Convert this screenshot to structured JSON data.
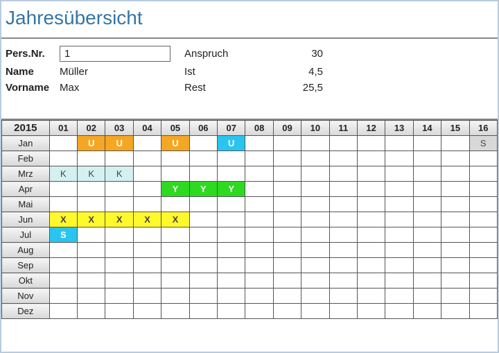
{
  "title": "Jahresübersicht",
  "info": {
    "persnr_label": "Pers.Nr.",
    "persnr_value": "1",
    "name_label": "Name",
    "name_value": "Müller",
    "vorname_label": "Vorname",
    "vorname_value": "Max",
    "anspruch_label": "Anspruch",
    "anspruch_value": "30",
    "ist_label": "Ist",
    "ist_value": "4,5",
    "rest_label": "Rest",
    "rest_value": "25,5"
  },
  "calendar": {
    "year": "2015",
    "days": [
      "01",
      "02",
      "03",
      "04",
      "05",
      "06",
      "07",
      "08",
      "09",
      "10",
      "11",
      "12",
      "13",
      "14",
      "15",
      "16"
    ],
    "months": [
      "Jan",
      "Feb",
      "Mrz",
      "Apr",
      "Mai",
      "Jun",
      "Jul",
      "Aug",
      "Sep",
      "Okt",
      "Nov",
      "Dez"
    ],
    "cells": {
      "Jan": {
        "02": {
          "v": "U",
          "c": "orange"
        },
        "03": {
          "v": "U",
          "c": "orange"
        },
        "05": {
          "v": "U",
          "c": "orange"
        },
        "07": {
          "v": "U",
          "c": "cyan"
        },
        "16": {
          "v": "S",
          "c": "gray"
        }
      },
      "Feb": {},
      "Mrz": {
        "01": {
          "v": "K",
          "c": "lightcyan"
        },
        "02": {
          "v": "K",
          "c": "lightcyan"
        },
        "03": {
          "v": "K",
          "c": "lightcyan"
        }
      },
      "Apr": {
        "05": {
          "v": "Y",
          "c": "green"
        },
        "06": {
          "v": "Y",
          "c": "green"
        },
        "07": {
          "v": "Y",
          "c": "green"
        }
      },
      "Mai": {},
      "Jun": {
        "01": {
          "v": "X",
          "c": "yellow"
        },
        "02": {
          "v": "X",
          "c": "yellow"
        },
        "03": {
          "v": "X",
          "c": "yellow"
        },
        "04": {
          "v": "X",
          "c": "yellow"
        },
        "05": {
          "v": "X",
          "c": "yellow"
        }
      },
      "Jul": {
        "01": {
          "v": "S",
          "c": "cyan"
        }
      },
      "Aug": {},
      "Sep": {},
      "Okt": {},
      "Nov": {},
      "Dez": {}
    }
  }
}
